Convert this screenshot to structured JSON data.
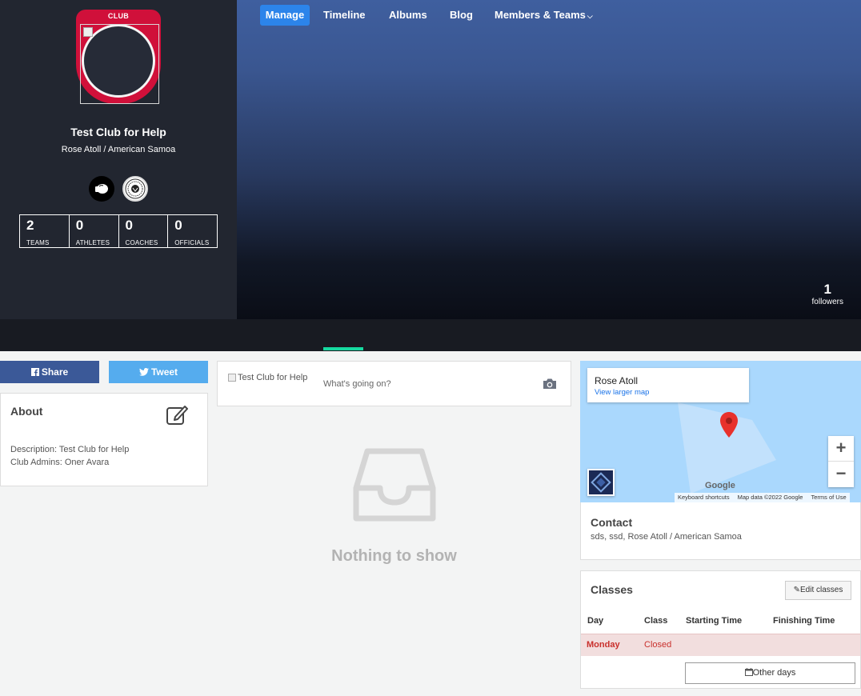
{
  "club": {
    "badge_label": "CLUB",
    "name": "Test Club for Help",
    "location": "Rose Atoll / American Samoa",
    "sports": [
      "boxing-glove-icon",
      "federation-seal-icon"
    ]
  },
  "stats": [
    {
      "value": "2",
      "label": "TEAMS"
    },
    {
      "value": "0",
      "label": "ATHLETES"
    },
    {
      "value": "0",
      "label": "COACHES"
    },
    {
      "value": "0",
      "label": "OFFICIALS"
    }
  ],
  "followers": {
    "count": "1",
    "label": "followers"
  },
  "nav": {
    "manage": "Manage",
    "timeline": "Timeline",
    "albums": "Albums",
    "blog": "Blog",
    "members": "Members & Teams"
  },
  "social": {
    "share": "Share",
    "tweet": "Tweet"
  },
  "about": {
    "title": "About",
    "description": "Description: Test Club for Help",
    "admins": "Club Admins: Oner Avara"
  },
  "post": {
    "avatar_alt": "Test Club for Help",
    "placeholder": "What's going on?"
  },
  "feed": {
    "empty_text": "Nothing to show"
  },
  "map": {
    "place": "Rose Atoll",
    "link": "View larger map",
    "zoom_in": "+",
    "zoom_out": "−",
    "google": "Google",
    "attribution": [
      "Keyboard shortcuts",
      "Map data ©2022 Google",
      "Terms of Use"
    ]
  },
  "contact": {
    "title": "Contact",
    "text": "sds, ssd, Rose Atoll / American Samoa"
  },
  "classes": {
    "title": "Classes",
    "edit_button": "Edit classes",
    "columns": [
      "Day",
      "Class",
      "Starting Time",
      "Finishing Time"
    ],
    "rows": [
      {
        "day": "Monday",
        "class": "Closed",
        "start": "",
        "finish": ""
      }
    ],
    "other_days_button": "Other days"
  },
  "colors": {
    "accent_blue": "#2c84ea",
    "timeline_underline": "#16d9a0",
    "facebook": "#3b5998",
    "twitter": "#55acee",
    "badge_red": "#d0103a",
    "closed_row_bg": "#f2dede",
    "closed_text": "#c9302c"
  }
}
